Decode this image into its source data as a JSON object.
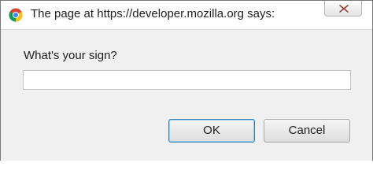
{
  "dialog": {
    "title": "The page at https://developer.mozilla.org says:",
    "app_icon": "chrome-icon",
    "close_icon": "close-icon"
  },
  "prompt": {
    "label": "What's your sign?",
    "input_value": "",
    "input_placeholder": ""
  },
  "buttons": {
    "ok_label": "OK",
    "cancel_label": "Cancel"
  },
  "colors": {
    "content_bg": "#f0f0f0",
    "ok_border": "#3c7fb1",
    "close_x": "#c0392b"
  }
}
